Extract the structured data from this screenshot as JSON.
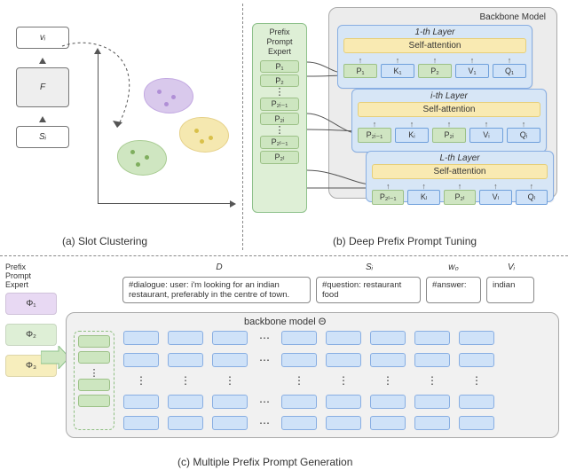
{
  "captions": {
    "a": "(a) Slot Clustering",
    "b": "(b) Deep Prefix Prompt Tuning",
    "c": "(c) Multiple Prefix Prompt Generation"
  },
  "panel_a": {
    "v": "vᵢ",
    "F": "F",
    "S": "Sᵢ"
  },
  "panel_b": {
    "backbone_label": "Backbone Model",
    "prefix_expert_title": "Prefix\nPrompt\nExpert",
    "layer1_title": "1-th Layer",
    "layeri_title": "i-th Layer",
    "layerL_title": "L-th Layer",
    "self_attention": "Self-attention",
    "expert_slots": [
      "P₁",
      "P₂",
      "P₂ᵢ₋₁",
      "P₂ᵢ",
      "P₂ₗ₋₁",
      "P₂ₗ"
    ],
    "row1": [
      "P₁",
      "K₁",
      "P₂",
      "V₁",
      "Q₁"
    ],
    "rowi": [
      "P₂ᵢ₋₁",
      "Kᵢ",
      "P₂ᵢ",
      "Vᵢ",
      "Qᵢ"
    ],
    "rowL": [
      "P₂ₗ₋₁",
      "Kₗ",
      "P₂ₗ",
      "Vₗ",
      "Qₗ"
    ]
  },
  "panel_c": {
    "labels": {
      "D": "D",
      "S": "Sᵢ",
      "w": "w₀",
      "V": "Vᵢ"
    },
    "inputs": {
      "D": "#dialogue: user: i'm looking for an indian restaurant, preferably in the centre of town.",
      "S": "#question: restaurant food",
      "w": "#answer:",
      "V": "indian"
    },
    "left_label": "Prefix\nPrompt\nExpert",
    "phi": {
      "p1": "Φ₁",
      "p2": "Φ₂",
      "p3": "Φ₃"
    },
    "backbone_label": "backbone model Θ"
  },
  "chart_data": {
    "type": "diagram",
    "title": "Prefix Prompt Architecture (three sub-figures)",
    "parts": [
      {
        "id": "a",
        "name": "Slot Clustering",
        "flow": [
          "S_i",
          "F",
          "v_i"
        ],
        "clusters": 3
      },
      {
        "id": "b",
        "name": "Deep Prefix Prompt Tuning",
        "layers": [
          "1",
          "i",
          "L"
        ],
        "per_layer_slots": [
          "P (prefix K-side)",
          "K",
          "P (prefix V-side)",
          "V",
          "Q"
        ],
        "prefix_expert_outputs": [
          "P1",
          "P2",
          "P_{2i-1}",
          "P_{2i}",
          "P_{2L-1}",
          "P_{2L}"
        ]
      },
      {
        "id": "c",
        "name": "Multiple Prefix Prompt Generation",
        "experts": [
          "Phi_1",
          "Phi_2",
          "Phi_3"
        ],
        "selected_expert": "Phi_2",
        "input_segments": [
          "D",
          "S_i",
          "w_0",
          "V_i"
        ],
        "backbone": "Theta"
      }
    ]
  }
}
